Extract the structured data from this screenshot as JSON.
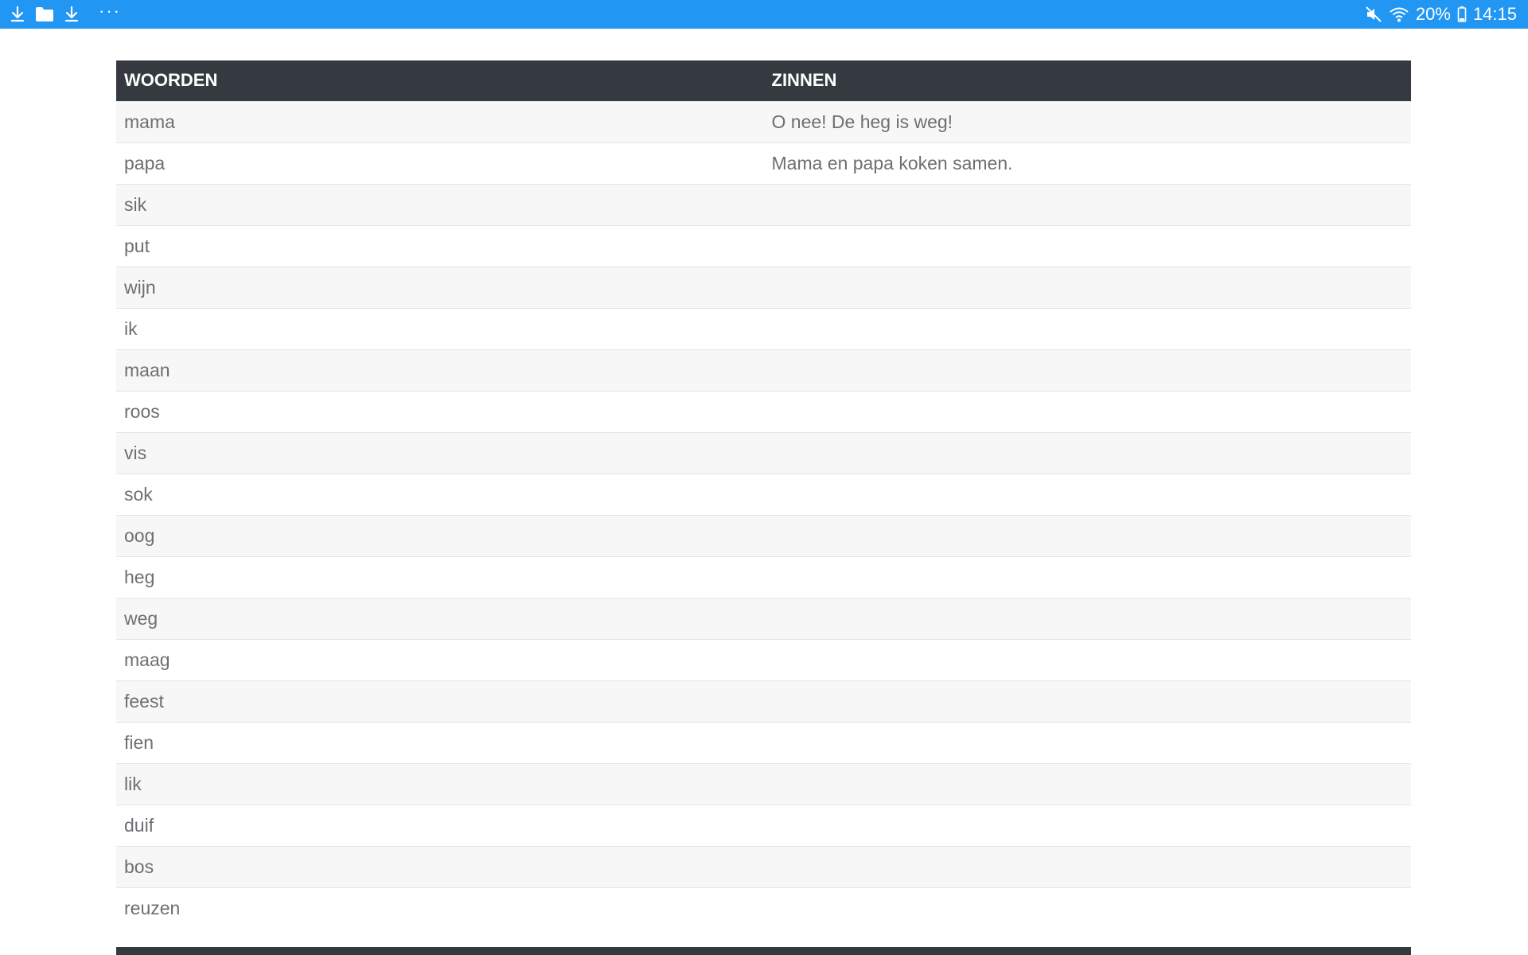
{
  "statusbar": {
    "battery": "20%",
    "time": "14:15",
    "icons_left": [
      "download-icon",
      "folder-icon",
      "download-icon",
      "more-icon"
    ],
    "icons_right": [
      "mute-icon",
      "wifi-icon",
      "battery-icon"
    ],
    "more": "···"
  },
  "table": {
    "headers": [
      "WOORDEN",
      "ZINNEN"
    ],
    "rows": [
      {
        "word": "mama",
        "sentence": "O nee! De heg is weg!"
      },
      {
        "word": "papa",
        "sentence": "Mama en papa koken samen."
      },
      {
        "word": "sik",
        "sentence": ""
      },
      {
        "word": "put",
        "sentence": ""
      },
      {
        "word": "wijn",
        "sentence": ""
      },
      {
        "word": "ik",
        "sentence": ""
      },
      {
        "word": "maan",
        "sentence": ""
      },
      {
        "word": "roos",
        "sentence": ""
      },
      {
        "word": "vis",
        "sentence": ""
      },
      {
        "word": "sok",
        "sentence": ""
      },
      {
        "word": "oog",
        "sentence": ""
      },
      {
        "word": "heg",
        "sentence": ""
      },
      {
        "word": "weg",
        "sentence": ""
      },
      {
        "word": "maag",
        "sentence": ""
      },
      {
        "word": "feest",
        "sentence": ""
      },
      {
        "word": "fien",
        "sentence": ""
      },
      {
        "word": "lik",
        "sentence": ""
      },
      {
        "word": "duif",
        "sentence": ""
      },
      {
        "word": "bos",
        "sentence": ""
      },
      {
        "word": "reuzen",
        "sentence": ""
      }
    ]
  },
  "colors": {
    "statusbar": "#2196f3",
    "header": "#343a40",
    "stripe": "#f7f7f7",
    "text": "#6c6f73"
  }
}
